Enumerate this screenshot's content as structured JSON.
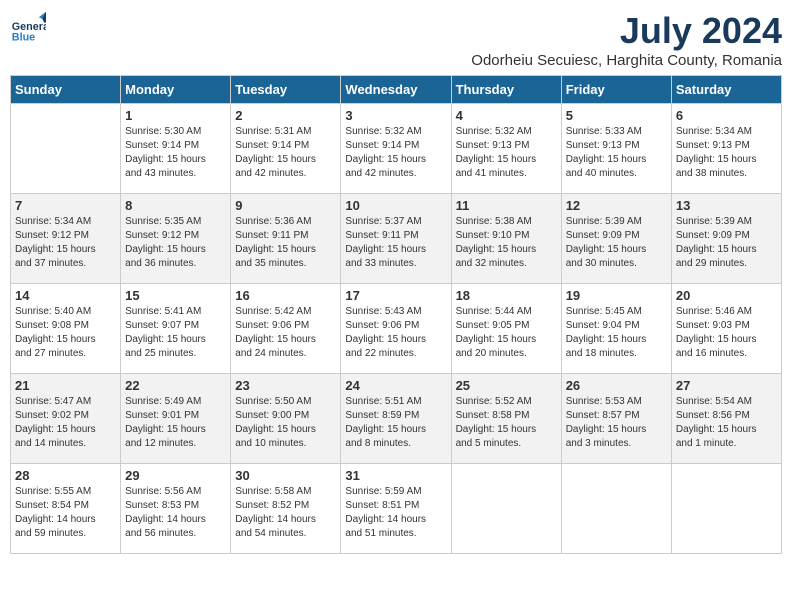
{
  "header": {
    "logo_line1": "General",
    "logo_line2": "Blue",
    "month_title": "July 2024",
    "subtitle": "Odorheiu Secuiesc, Harghita County, Romania"
  },
  "weekdays": [
    "Sunday",
    "Monday",
    "Tuesday",
    "Wednesday",
    "Thursday",
    "Friday",
    "Saturday"
  ],
  "weeks": [
    [
      {
        "day": "",
        "info": ""
      },
      {
        "day": "1",
        "info": "Sunrise: 5:30 AM\nSunset: 9:14 PM\nDaylight: 15 hours\nand 43 minutes."
      },
      {
        "day": "2",
        "info": "Sunrise: 5:31 AM\nSunset: 9:14 PM\nDaylight: 15 hours\nand 42 minutes."
      },
      {
        "day": "3",
        "info": "Sunrise: 5:32 AM\nSunset: 9:14 PM\nDaylight: 15 hours\nand 42 minutes."
      },
      {
        "day": "4",
        "info": "Sunrise: 5:32 AM\nSunset: 9:13 PM\nDaylight: 15 hours\nand 41 minutes."
      },
      {
        "day": "5",
        "info": "Sunrise: 5:33 AM\nSunset: 9:13 PM\nDaylight: 15 hours\nand 40 minutes."
      },
      {
        "day": "6",
        "info": "Sunrise: 5:34 AM\nSunset: 9:13 PM\nDaylight: 15 hours\nand 38 minutes."
      }
    ],
    [
      {
        "day": "7",
        "info": "Sunrise: 5:34 AM\nSunset: 9:12 PM\nDaylight: 15 hours\nand 37 minutes."
      },
      {
        "day": "8",
        "info": "Sunrise: 5:35 AM\nSunset: 9:12 PM\nDaylight: 15 hours\nand 36 minutes."
      },
      {
        "day": "9",
        "info": "Sunrise: 5:36 AM\nSunset: 9:11 PM\nDaylight: 15 hours\nand 35 minutes."
      },
      {
        "day": "10",
        "info": "Sunrise: 5:37 AM\nSunset: 9:11 PM\nDaylight: 15 hours\nand 33 minutes."
      },
      {
        "day": "11",
        "info": "Sunrise: 5:38 AM\nSunset: 9:10 PM\nDaylight: 15 hours\nand 32 minutes."
      },
      {
        "day": "12",
        "info": "Sunrise: 5:39 AM\nSunset: 9:09 PM\nDaylight: 15 hours\nand 30 minutes."
      },
      {
        "day": "13",
        "info": "Sunrise: 5:39 AM\nSunset: 9:09 PM\nDaylight: 15 hours\nand 29 minutes."
      }
    ],
    [
      {
        "day": "14",
        "info": "Sunrise: 5:40 AM\nSunset: 9:08 PM\nDaylight: 15 hours\nand 27 minutes."
      },
      {
        "day": "15",
        "info": "Sunrise: 5:41 AM\nSunset: 9:07 PM\nDaylight: 15 hours\nand 25 minutes."
      },
      {
        "day": "16",
        "info": "Sunrise: 5:42 AM\nSunset: 9:06 PM\nDaylight: 15 hours\nand 24 minutes."
      },
      {
        "day": "17",
        "info": "Sunrise: 5:43 AM\nSunset: 9:06 PM\nDaylight: 15 hours\nand 22 minutes."
      },
      {
        "day": "18",
        "info": "Sunrise: 5:44 AM\nSunset: 9:05 PM\nDaylight: 15 hours\nand 20 minutes."
      },
      {
        "day": "19",
        "info": "Sunrise: 5:45 AM\nSunset: 9:04 PM\nDaylight: 15 hours\nand 18 minutes."
      },
      {
        "day": "20",
        "info": "Sunrise: 5:46 AM\nSunset: 9:03 PM\nDaylight: 15 hours\nand 16 minutes."
      }
    ],
    [
      {
        "day": "21",
        "info": "Sunrise: 5:47 AM\nSunset: 9:02 PM\nDaylight: 15 hours\nand 14 minutes."
      },
      {
        "day": "22",
        "info": "Sunrise: 5:49 AM\nSunset: 9:01 PM\nDaylight: 15 hours\nand 12 minutes."
      },
      {
        "day": "23",
        "info": "Sunrise: 5:50 AM\nSunset: 9:00 PM\nDaylight: 15 hours\nand 10 minutes."
      },
      {
        "day": "24",
        "info": "Sunrise: 5:51 AM\nSunset: 8:59 PM\nDaylight: 15 hours\nand 8 minutes."
      },
      {
        "day": "25",
        "info": "Sunrise: 5:52 AM\nSunset: 8:58 PM\nDaylight: 15 hours\nand 5 minutes."
      },
      {
        "day": "26",
        "info": "Sunrise: 5:53 AM\nSunset: 8:57 PM\nDaylight: 15 hours\nand 3 minutes."
      },
      {
        "day": "27",
        "info": "Sunrise: 5:54 AM\nSunset: 8:56 PM\nDaylight: 15 hours\nand 1 minute."
      }
    ],
    [
      {
        "day": "28",
        "info": "Sunrise: 5:55 AM\nSunset: 8:54 PM\nDaylight: 14 hours\nand 59 minutes."
      },
      {
        "day": "29",
        "info": "Sunrise: 5:56 AM\nSunset: 8:53 PM\nDaylight: 14 hours\nand 56 minutes."
      },
      {
        "day": "30",
        "info": "Sunrise: 5:58 AM\nSunset: 8:52 PM\nDaylight: 14 hours\nand 54 minutes."
      },
      {
        "day": "31",
        "info": "Sunrise: 5:59 AM\nSunset: 8:51 PM\nDaylight: 14 hours\nand 51 minutes."
      },
      {
        "day": "",
        "info": ""
      },
      {
        "day": "",
        "info": ""
      },
      {
        "day": "",
        "info": ""
      }
    ]
  ]
}
